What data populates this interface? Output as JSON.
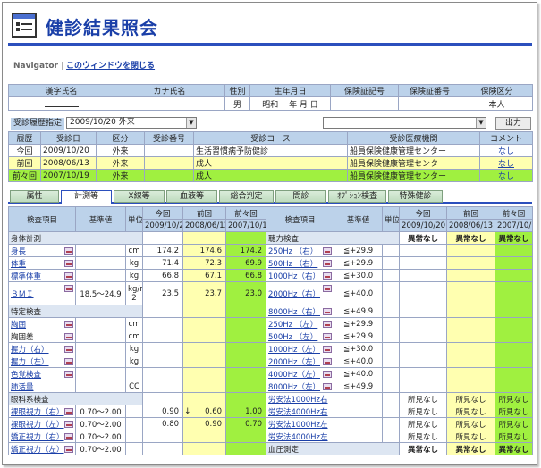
{
  "app": {
    "title": "健診結果照会"
  },
  "nav": {
    "label": "Navigator",
    "close_link": "このウィンドウを閉じる"
  },
  "person": {
    "headers": [
      "漢字氏名",
      "カナ氏名",
      "性別",
      "生年月日",
      "保険証記号",
      "保険証番号",
      "保険区分"
    ],
    "values": [
      "",
      "",
      "男",
      "昭和　 年 月 日",
      "",
      "",
      "本人"
    ]
  },
  "history_bar": {
    "label": "受診履歴指定",
    "selected": "2009/10/20 外来",
    "institution_selected": "",
    "output_button": "出力"
  },
  "history": {
    "headers": [
      "履歴",
      "受診日",
      "区分",
      "受診番号",
      "受診コース",
      "受診医療機関",
      "コメント"
    ],
    "rows": [
      [
        "今回",
        "2009/10/20",
        "外来",
        "",
        "生活習慣病予防健診",
        "船員保険健康管理センター",
        "なし"
      ],
      [
        "前回",
        "2008/06/13",
        "外来",
        "",
        "成人",
        "船員保険健康管理センター",
        "なし"
      ],
      [
        "前々回",
        "2007/10/19",
        "外来",
        "",
        "成人",
        "船員保険健康管理センター",
        "なし"
      ]
    ],
    "row_colors": [
      "#ffffff",
      "#ffffb0",
      "#a0f040"
    ]
  },
  "tabs": [
    "属性",
    "計測等",
    "X線等",
    "血液等",
    "総合判定",
    "問診",
    "ｵﾌﾟｼｮﾝ検査",
    "特殊健診"
  ],
  "active_tab": 1,
  "results": {
    "headers_left": {
      "item": "検査項目",
      "ref": "基準値",
      "unit": "単位",
      "cur": "今回",
      "prev": "前回",
      "prev2": "前々回"
    },
    "dates": [
      "2009/10/20",
      "2008/06/13",
      "2007/10/19"
    ],
    "headers_right": {
      "item": "検査項目",
      "ref": "基準値",
      "unit": "単位",
      "cur": "今回",
      "prev": "前回",
      "prev2": "前々回"
    },
    "rows": [
      {
        "l": {
          "type": "sec",
          "label": "身体計測"
        },
        "r": {
          "type": "sec",
          "label": "聴力検査",
          "v": [
            "異常なし",
            "異常なし",
            "異常なし"
          ]
        }
      },
      {
        "l": {
          "label": "身長",
          "link": true,
          "g": true,
          "ref": "",
          "unit": "cm",
          "v": [
            "174.2",
            "174.6",
            "174.2"
          ]
        },
        "r": {
          "label": "250Hz （右）",
          "link": true,
          "g": true,
          "ref": "≦+29.9",
          "v": [
            "",
            "",
            ""
          ]
        }
      },
      {
        "l": {
          "label": "体重",
          "link": true,
          "g": true,
          "ref": "",
          "unit": "kg",
          "v": [
            "71.4",
            "72.3",
            "69.9"
          ]
        },
        "r": {
          "label": "500Hz （右）",
          "link": true,
          "g": true,
          "ref": "≦+29.9",
          "v": [
            "",
            "",
            ""
          ]
        }
      },
      {
        "l": {
          "label": "標準体重",
          "link": true,
          "g": true,
          "ref": "",
          "unit": "kg",
          "v": [
            "66.8",
            "67.1",
            "66.8"
          ]
        },
        "r": {
          "label": "1000Hz（右）",
          "link": true,
          "g": true,
          "ref": "≦+30.0",
          "v": [
            "",
            "",
            ""
          ]
        }
      },
      {
        "l": {
          "label": "ＢＭＩ",
          "link": true,
          "g": true,
          "ref": "18.5～24.9",
          "unit": "kg/m",
          "unit2": "2",
          "v": [
            "23.5",
            "23.7",
            "23.0"
          ],
          "tall": true
        },
        "r": {
          "label": "2000Hz（右）",
          "link": true,
          "g": true,
          "ref": "≦+40.0",
          "v": [
            "",
            "",
            ""
          ],
          "tall2": true
        }
      },
      {
        "l": {
          "type": "sec",
          "label": "特定検査"
        },
        "r": {
          "label": "8000Hz（右）",
          "link": true,
          "g": true,
          "ref": "≦+49.9",
          "v": [
            "",
            "",
            ""
          ]
        }
      },
      {
        "l": {
          "label": "胸囲",
          "link": true,
          "g": true,
          "ref": "",
          "unit": "cm",
          "v": [
            "",
            "",
            ""
          ]
        },
        "r": {
          "label": "250Hz （左）",
          "link": true,
          "g": true,
          "ref": "≦+29.9",
          "v": [
            "",
            "",
            ""
          ]
        }
      },
      {
        "l": {
          "label": "胸囲差",
          "link": false,
          "g": true,
          "ref": "",
          "unit": "cm",
          "v": [
            "",
            "",
            ""
          ]
        },
        "r": {
          "label": "500Hz （左）",
          "link": true,
          "g": true,
          "ref": "≦+29.9",
          "v": [
            "",
            "",
            ""
          ]
        }
      },
      {
        "l": {
          "label": "握力（右）",
          "link": true,
          "g": true,
          "ref": "",
          "unit": "kg",
          "v": [
            "",
            "",
            ""
          ]
        },
        "r": {
          "label": "1000Hz（左）",
          "link": true,
          "g": true,
          "ref": "≦+30.0",
          "v": [
            "",
            "",
            ""
          ]
        }
      },
      {
        "l": {
          "label": "握力（左）",
          "link": true,
          "g": true,
          "ref": "",
          "unit": "kg",
          "v": [
            "",
            "",
            ""
          ]
        },
        "r": {
          "label": "2000Hz（左）",
          "link": true,
          "g": true,
          "ref": "≦+40.0",
          "v": [
            "",
            "",
            ""
          ]
        }
      },
      {
        "l": {
          "label": "色覚検査",
          "link": true,
          "g": true,
          "ref": "",
          "unit": "",
          "v": [
            "",
            "",
            ""
          ]
        },
        "r": {
          "label": "4000Hz（左）",
          "link": true,
          "g": true,
          "ref": "≦+40.0",
          "v": [
            "",
            "",
            ""
          ]
        }
      },
      {
        "l": {
          "label": "肺活量",
          "link": true,
          "g": false,
          "ref": "",
          "unit": "CC",
          "v": [
            "",
            "",
            ""
          ]
        },
        "r": {
          "label": "8000Hz（左）",
          "link": true,
          "g": true,
          "ref": "≦+49.9",
          "v": [
            "",
            "",
            ""
          ]
        }
      },
      {
        "l": {
          "type": "sec",
          "label": "眼科系検査"
        },
        "r": {
          "label": "労安法1000Hz右",
          "link": true,
          "g": false,
          "ref": "",
          "v": [
            "所見なし",
            "所見なし",
            "所見なし"
          ]
        }
      },
      {
        "l": {
          "label": "裸眼視力（右）",
          "link": true,
          "g": true,
          "ref": "0.70～2.00",
          "unit": "",
          "v": [
            "0.90",
            "0.60",
            "1.00"
          ],
          "mark": "↓"
        },
        "r": {
          "label": "労安法4000Hz右",
          "link": true,
          "g": false,
          "ref": "",
          "v": [
            "所見なし",
            "所見なし",
            "所見なし"
          ]
        }
      },
      {
        "l": {
          "label": "裸眼視力（左）",
          "link": true,
          "g": true,
          "ref": "0.70～2.00",
          "unit": "",
          "v": [
            "0.80",
            "0.90",
            "0.70"
          ]
        },
        "r": {
          "label": "労安法1000Hz左",
          "link": true,
          "g": false,
          "ref": "",
          "v": [
            "所見なし",
            "所見なし",
            "所見なし"
          ]
        }
      },
      {
        "l": {
          "label": "矯正視力（右）",
          "link": true,
          "g": true,
          "ref": "0.70～2.00",
          "unit": "",
          "v": [
            "",
            "",
            ""
          ]
        },
        "r": {
          "label": "労安法4000Hz左",
          "link": true,
          "g": false,
          "ref": "",
          "v": [
            "所見なし",
            "所見なし",
            "所見なし"
          ]
        }
      },
      {
        "l": {
          "label": "矯正視力（左）",
          "link": true,
          "g": true,
          "ref": "0.70～2.00",
          "unit": "",
          "v": [
            "",
            "",
            ""
          ]
        },
        "r": {
          "type": "sec",
          "label": "血圧測定",
          "v": [
            "異常なし",
            "異常なし",
            "異常なし"
          ]
        }
      }
    ]
  }
}
